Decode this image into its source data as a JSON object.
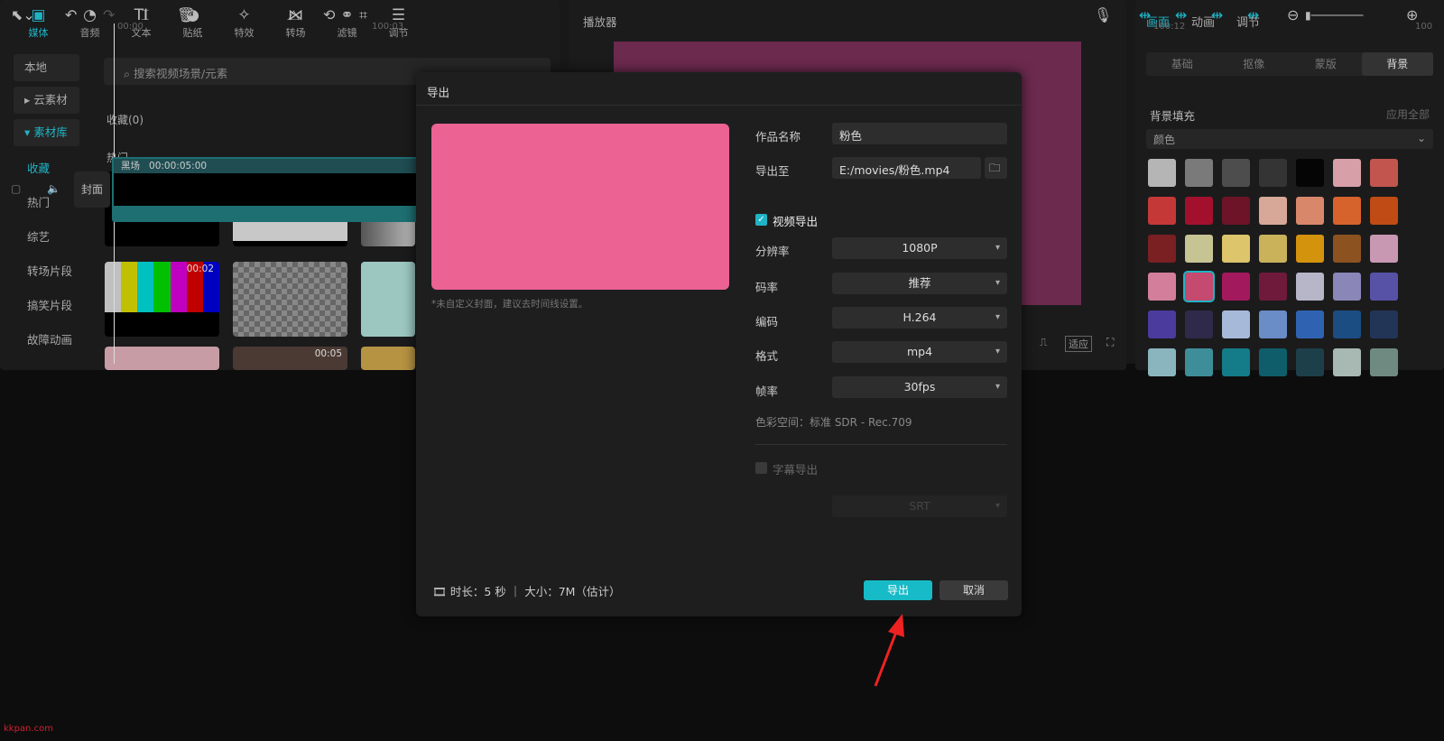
{
  "media_panel": {
    "tabs": [
      {
        "label": "媒体",
        "icon": "media-icon",
        "glyph": "▣"
      },
      {
        "label": "音频",
        "icon": "audio-icon",
        "glyph": "◔"
      },
      {
        "label": "文本",
        "icon": "text-icon",
        "glyph": "TI"
      },
      {
        "label": "贴纸",
        "icon": "sticker-icon",
        "glyph": "◕"
      },
      {
        "label": "特效",
        "icon": "effects-icon",
        "glyph": "✧"
      },
      {
        "label": "转场",
        "icon": "transition-icon",
        "glyph": "⋈"
      },
      {
        "label": "滤镜",
        "icon": "filter-icon",
        "glyph": "⚭"
      },
      {
        "label": "调节",
        "icon": "adjust-icon",
        "glyph": "☰"
      }
    ],
    "nav": {
      "local": "本地",
      "cloud": "云素材",
      "library": "素材库",
      "items": [
        "收藏",
        "热门",
        "综艺",
        "转场片段",
        "搞笑片段",
        "故障动画"
      ]
    },
    "search_placeholder": "搜索视频场景/元素",
    "favorites_label": "收藏(0)",
    "hot_label": "热门",
    "thumb_durations": [
      "00:02",
      "00:05"
    ]
  },
  "player": {
    "title": "播放器",
    "canvas_color": "#6c2a4e",
    "fit_label": "适应"
  },
  "props_panel": {
    "tabs": [
      "画面",
      "动画",
      "调节"
    ],
    "subtabs": [
      "基础",
      "抠像",
      "蒙版",
      "背景"
    ],
    "fill_header": "背景填充",
    "apply_all": "应用全部",
    "fill_type": "颜色",
    "swatches": [
      "#b5b5b5",
      "#7a7a7a",
      "#4d4d4d",
      "#343434",
      "#050505",
      "#d7a0a8",
      "#c3554f",
      "#c43838",
      "#a3102d",
      "#6e1428",
      "#d7a897",
      "#d9876b",
      "#d6632c",
      "#c04b14",
      "#7a1f22",
      "#c7c493",
      "#dcc56b",
      "#c9b25a",
      "#d4930d",
      "#8c5220",
      "#c898b3",
      "#d37e9a",
      "#c44a70",
      "#a3195e",
      "#6f1a3b",
      "#b6b6c8",
      "#8b86b8",
      "#5752a6",
      "#4a3b9c",
      "#2f2a4a",
      "#a6b9d8",
      "#6a8cc7",
      "#2f63b2",
      "#1b4d83",
      "#223557",
      "#8ab5bf",
      "#3d8e99",
      "#137c88",
      "#0f5d6b",
      "#1d3f4a",
      "#a8b8b2",
      "#6e8a81"
    ]
  },
  "timeline": {
    "ruler_labels": [
      "00:00",
      "100:03",
      "100:12",
      "100"
    ],
    "clip_label": "黑场",
    "clip_duration": "00:00:05:00",
    "cover_label": "封面"
  },
  "export_dialog": {
    "title": "导出",
    "cover_color": "#eb6293",
    "cover_hint": "*未自定义封面，建议去时间线设置。",
    "name_label": "作品名称",
    "name_value": "粉色",
    "path_label": "导出至",
    "path_value": "E:/movies/粉色.mp4",
    "video_export_label": "视频导出",
    "video_export_checked": true,
    "resolution_label": "分辨率",
    "resolution_value": "1080P",
    "bitrate_label": "码率",
    "bitrate_value": "推荐",
    "codec_label": "编码",
    "codec_value": "H.264",
    "format_label": "格式",
    "format_value": "mp4",
    "fps_label": "帧率",
    "fps_value": "30fps",
    "color_space": "色彩空间：标准 SDR - Rec.709",
    "subtitle_export_label": "字幕导出",
    "subtitle_export_checked": false,
    "subtitle_format_value": "SRT",
    "footer_info": "时长：5 秒 ｜ 大小：7M（估计）",
    "export_button": "导出",
    "cancel_button": "取消"
  },
  "watermark": "kkpan.com"
}
